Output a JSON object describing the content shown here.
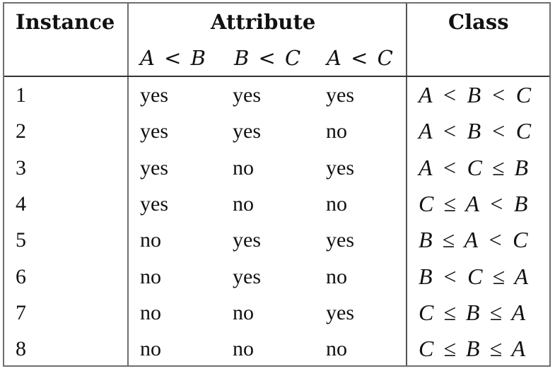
{
  "table": {
    "headers": {
      "instance": "Instance",
      "attribute": "Attribute",
      "class": "Class"
    },
    "attribute_subheaders": [
      "A < B",
      "B < C",
      "A < C"
    ],
    "rows": [
      {
        "instance": "1",
        "attributes": [
          "yes",
          "yes",
          "yes"
        ],
        "class": "A < B < C"
      },
      {
        "instance": "2",
        "attributes": [
          "yes",
          "yes",
          "no"
        ],
        "class": "A < B < C"
      },
      {
        "instance": "3",
        "attributes": [
          "yes",
          "no",
          "yes"
        ],
        "class": "A < C ≤ B"
      },
      {
        "instance": "4",
        "attributes": [
          "yes",
          "no",
          "no"
        ],
        "class": "C ≤ A < B"
      },
      {
        "instance": "5",
        "attributes": [
          "no",
          "yes",
          "yes"
        ],
        "class": "B ≤ A < C"
      },
      {
        "instance": "6",
        "attributes": [
          "no",
          "yes",
          "no"
        ],
        "class": "B < C ≤ A"
      },
      {
        "instance": "7",
        "attributes": [
          "no",
          "no",
          "yes"
        ],
        "class": "C ≤ B ≤ A"
      },
      {
        "instance": "8",
        "attributes": [
          "no",
          "no",
          "no"
        ],
        "class": "C ≤ B ≤ A"
      }
    ]
  }
}
